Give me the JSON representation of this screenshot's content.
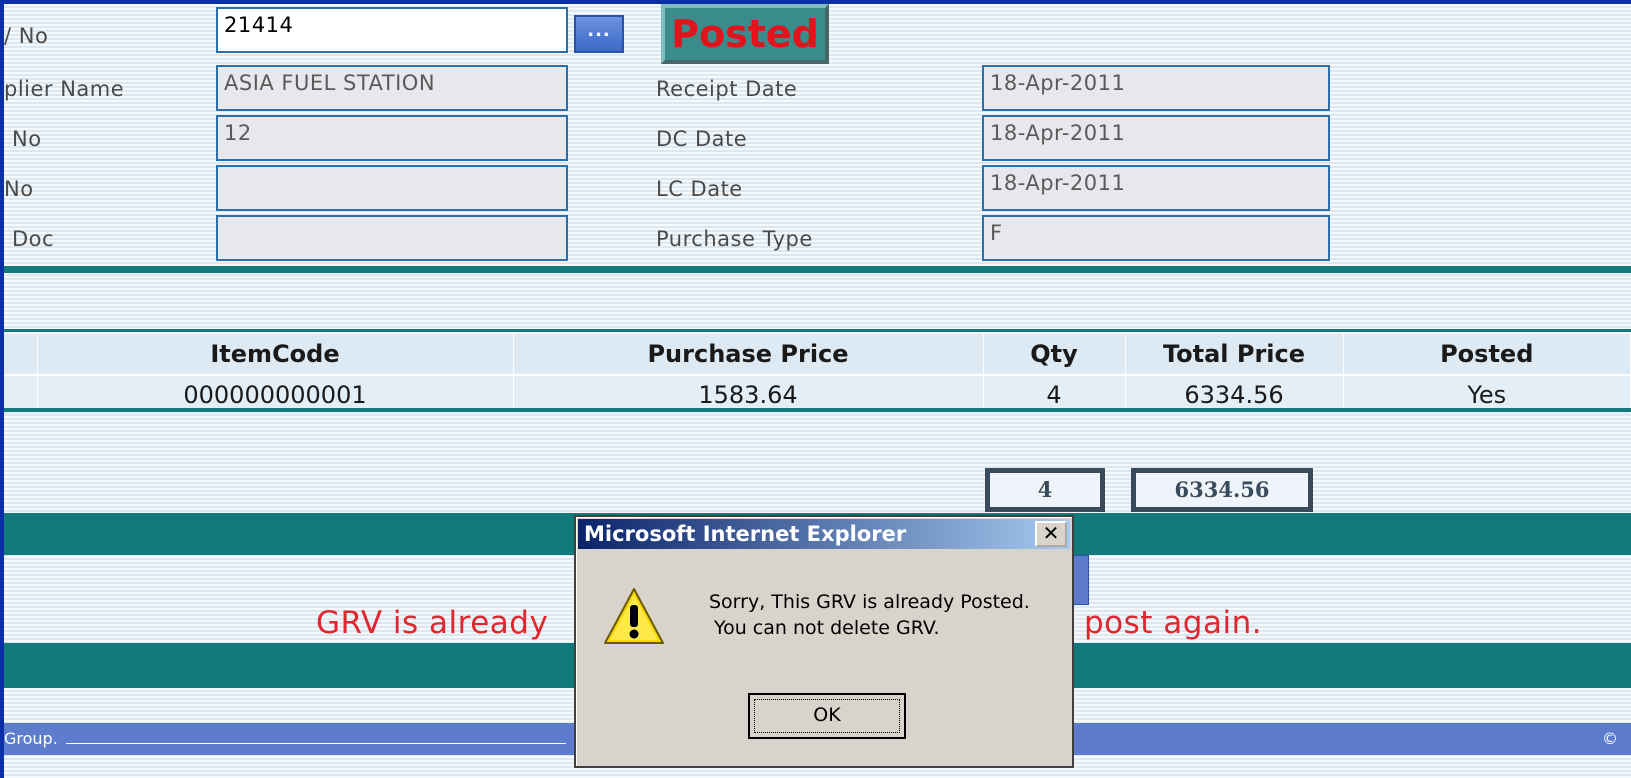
{
  "form": {
    "grv_no_label": "/ No",
    "grv_no_value": "21414",
    "browse_label": "...",
    "status_label": "Posted",
    "supplier_label": "plier Name",
    "supplier_value": "ASIA FUEL STATION",
    "dc_no_label": "No",
    "dc_no_value": "12",
    "lc_no_label": "No",
    "lc_no_value": "",
    "doc_label": "Doc",
    "doc_value": "",
    "receipt_date_label": "Receipt Date",
    "receipt_date_value": "18-Apr-2011",
    "dc_date_label": "DC Date",
    "dc_date_value": "18-Apr-2011",
    "lc_date_label": "LC Date",
    "lc_date_value": "18-Apr-2011",
    "purchase_type_label": "Purchase Type",
    "purchase_type_value": "F"
  },
  "grid": {
    "headers": {
      "item_code": "ItemCode",
      "purchase_price": "Purchase Price",
      "qty": "Qty",
      "total_price": "Total Price",
      "posted": "Posted"
    },
    "rows": [
      {
        "item_code": "000000000001",
        "purchase_price": "1583.64",
        "qty": "4",
        "total_price": "6334.56",
        "posted": "Yes"
      }
    ]
  },
  "totals": {
    "qty": "4",
    "total_price": "6334.56"
  },
  "status_message": {
    "left": "GRV is already",
    "right": "post again."
  },
  "footer": {
    "left_text": "Group.",
    "right_symbol": "©"
  },
  "dialog": {
    "title": "Microsoft Internet Explorer",
    "close_symbol": "✕",
    "message_line1": "Sorry, This GRV is already Posted.",
    "message_line2": "You can not delete GRV.",
    "ok_label": "OK",
    "icon": "warning-icon"
  },
  "colors": {
    "teal": "#127a7a",
    "error_red": "#e0262f",
    "dialog_title_start": "#0a246a",
    "dialog_title_end": "#a6caf0",
    "footer_blue": "#5d7dcc"
  }
}
